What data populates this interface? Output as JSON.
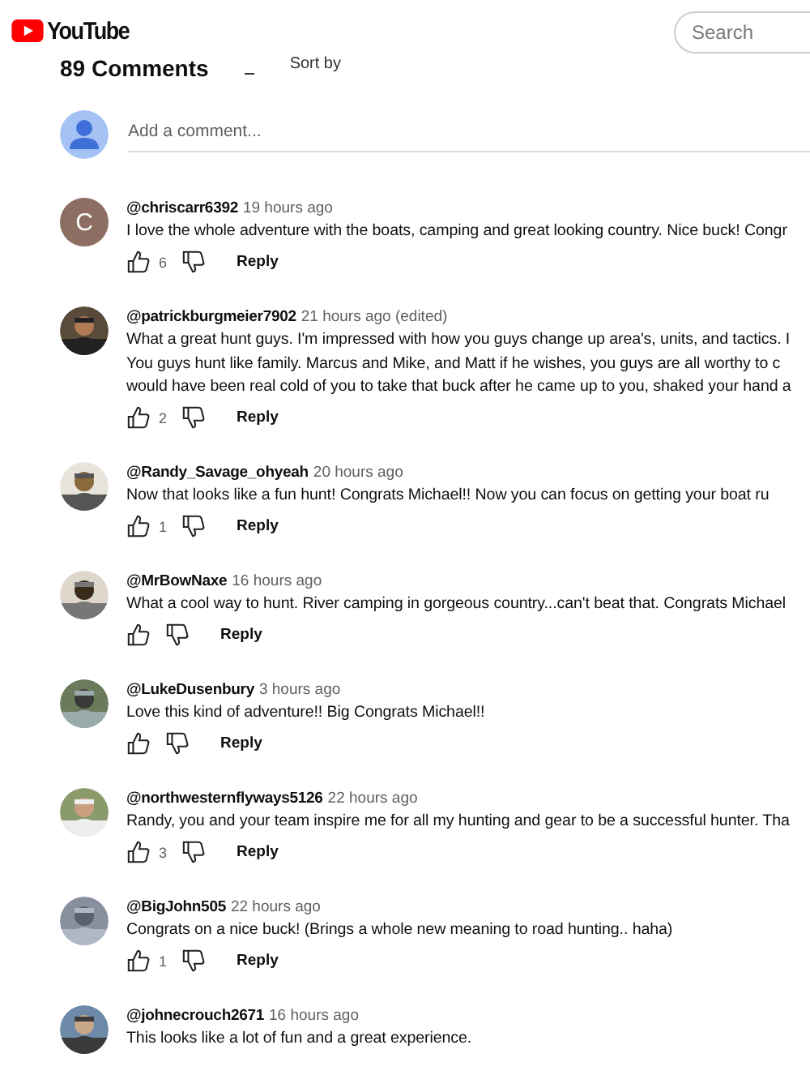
{
  "header": {
    "logo_text": "YouTube",
    "search": {
      "placeholder": "Search"
    }
  },
  "comments_header": {
    "count": "89 Comments",
    "sort": "Sort by"
  },
  "add_comment": {
    "placeholder": "Add a comment..."
  },
  "comments": [
    {
      "author": "@chriscarr6392",
      "time": "19 hours ago",
      "avatar": {
        "kind": "letter",
        "letter": "C",
        "color": "#8d6e63"
      },
      "lines": [
        "I love the whole adventure with the boats, camping and great looking country. Nice buck! Congr"
      ],
      "likes": "6",
      "reply": "Reply"
    },
    {
      "author": "@patrickburgmeier7902",
      "time": "21 hours ago (edited)",
      "lines": [
        "What a great hunt guys. I'm impressed with how you guys change up area's, units, and tactics. I",
        "You guys hunt like family.  Marcus and Mike, and Matt if he wishes, you guys are all worthy to c",
        "would have been real cold of you to take that buck after he came up to you, shaked your hand a"
      ],
      "likes": "2",
      "reply": "Reply"
    },
    {
      "author": "@Randy_Savage_ohyeah",
      "time": "20 hours ago",
      "lines": [
        "Now that looks like a fun hunt!  Congrats Michael!!  Now you can focus on getting your boat ru"
      ],
      "likes": "1",
      "reply": "Reply"
    },
    {
      "author": "@MrBowNaxe",
      "time": "16 hours ago",
      "lines": [
        "What a cool way to hunt. River camping in gorgeous country...can't beat that. Congrats Michael"
      ],
      "reply": "Reply"
    },
    {
      "author": "@LukeDusenbury",
      "time": "3 hours ago",
      "lines": [
        "Love this kind of adventure!! Big Congrats Michael!!"
      ],
      "reply": "Reply"
    },
    {
      "author": "@northwesternflyways5126",
      "time": "22 hours ago",
      "lines": [
        "Randy, you and your team inspire me for all my hunting and gear to be a successful hunter. Tha"
      ],
      "likes": "3",
      "reply": "Reply"
    },
    {
      "author": "@BigJohn505",
      "time": "22 hours ago",
      "lines": [
        "Congrats on a nice buck!  (Brings a whole new meaning to road hunting.. haha)"
      ],
      "likes": "1",
      "reply": "Reply"
    },
    {
      "author": "@johnecrouch2671",
      "time": "16 hours ago",
      "lines": [
        "This looks like a lot of fun and a great experience."
      ]
    }
  ]
}
